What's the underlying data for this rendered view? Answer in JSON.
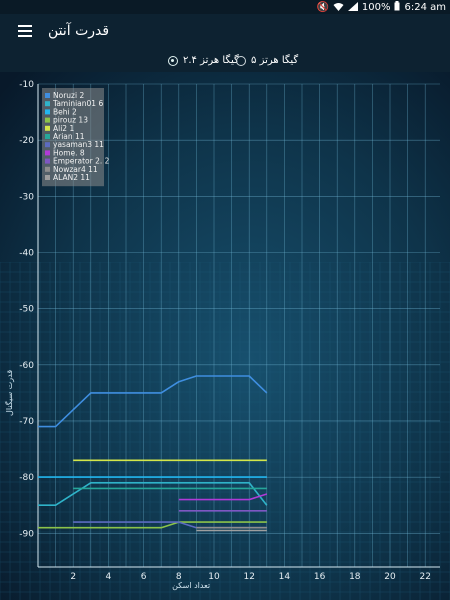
{
  "status_bar": {
    "time": "6:24 am",
    "battery": "100%",
    "icons": [
      "battery-icon",
      "signal-icon",
      "wifi-icon",
      "mute-icon"
    ]
  },
  "app_bar": {
    "title": "قدرت آنتن",
    "menu_icon": "menu-icon"
  },
  "band_selector": {
    "option_24": "۲.۴ گیگا هرتز",
    "option_5": "۵ گیگا هرتز",
    "selected": "option_24"
  },
  "chart_data": {
    "type": "line",
    "title": "",
    "xlabel": "تعداد اسکن",
    "ylabel": "قدرت سیگنال",
    "xlim": [
      0,
      24
    ],
    "ylim": [
      -96,
      -10
    ],
    "x_ticks": [
      2,
      4,
      6,
      8,
      10,
      12,
      14,
      16,
      18,
      20,
      22
    ],
    "y_ticks": [
      -10,
      -20,
      -30,
      -40,
      -50,
      -60,
      -70,
      -80,
      -90
    ],
    "legend_position": "top-left",
    "series": [
      {
        "name": "Noruzi 2",
        "color": "#3f8ee0",
        "points": [
          [
            0,
            -71
          ],
          [
            1,
            -71
          ],
          [
            3,
            -65
          ],
          [
            7,
            -65
          ],
          [
            8,
            -63
          ],
          [
            9,
            -62
          ],
          [
            12,
            -62
          ],
          [
            13,
            -65
          ]
        ]
      },
      {
        "name": "Taminian01 6",
        "color": "#2fb3c9",
        "points": [
          [
            0,
            -85
          ],
          [
            1,
            -85
          ],
          [
            3,
            -81
          ],
          [
            12,
            -81
          ],
          [
            13,
            -85
          ]
        ]
      },
      {
        "name": "Behi 2",
        "color": "#22b7f0",
        "points": [
          [
            0,
            -80
          ],
          [
            13,
            -80
          ]
        ]
      },
      {
        "name": "pirouz 13",
        "color": "#8bc34a",
        "points": [
          [
            0,
            -89
          ],
          [
            7,
            -89
          ],
          [
            8,
            -88
          ],
          [
            13,
            -88
          ]
        ]
      },
      {
        "name": "Ali2 1",
        "color": "#d4e64a",
        "points": [
          [
            2,
            -77
          ],
          [
            13,
            -77
          ]
        ]
      },
      {
        "name": "Arian 11",
        "color": "#26a69a",
        "points": [
          [
            2,
            -82
          ],
          [
            13,
            -82
          ]
        ]
      },
      {
        "name": "yasaman3 11",
        "color": "#5c6bc0",
        "points": [
          [
            2,
            -88
          ],
          [
            8,
            -88
          ],
          [
            9,
            -89
          ],
          [
            13,
            -89
          ]
        ]
      },
      {
        "name": "Home. 8",
        "color": "#b03ad8",
        "points": [
          [
            8,
            -84
          ],
          [
            12,
            -84
          ],
          [
            13,
            -83
          ]
        ]
      },
      {
        "name": "Emperator 2. 2",
        "color": "#7e57c2",
        "points": [
          [
            8,
            -86
          ],
          [
            13,
            -86
          ]
        ]
      },
      {
        "name": "Nowzar4 11",
        "color": "#8e8e8e",
        "points": [
          [
            9,
            -89
          ],
          [
            13,
            -89
          ]
        ]
      },
      {
        "name": "ALAN2 11",
        "color": "#9e9e9e",
        "points": [
          [
            9,
            -89.5
          ],
          [
            13,
            -89.5
          ]
        ]
      }
    ]
  }
}
